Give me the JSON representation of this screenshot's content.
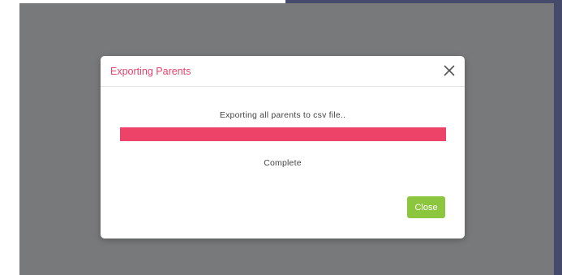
{
  "modal": {
    "title": "Exporting Parents",
    "message": "Exporting all parents to csv file..",
    "progress_percent": 100,
    "status": "Complete",
    "close_button_label": "Close",
    "close_icon": "close-icon"
  },
  "colors": {
    "title": "#e8436a",
    "progress_fill": "#ee4369",
    "close_button": "#8cc63f",
    "backdrop": "#78797b",
    "app_strip": "#454a6b"
  }
}
